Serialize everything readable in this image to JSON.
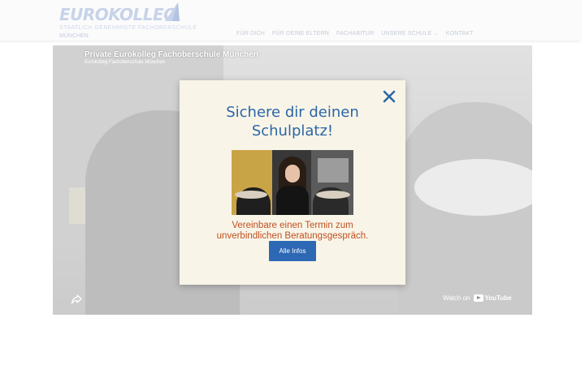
{
  "header": {
    "logo": {
      "name": "EUROKOLLEG",
      "tagline": "STAATLICH GENEHMIGTE FACHOBERSCHULE",
      "city": "MÜNCHEN"
    },
    "nav": [
      {
        "label": "FÜR DICH"
      },
      {
        "label": "FÜR DEINE ELTERN"
      },
      {
        "label": "FACHABITUR"
      },
      {
        "label": "UNSERE SCHULE",
        "has_dropdown": true
      },
      {
        "label": "KONTAKT"
      }
    ]
  },
  "video": {
    "title": "Private Eurokolleg Fachoberschule München",
    "channel": "Eurokolleg Fachoberschule München",
    "watch_on": "Watch on",
    "youtube": "YouTube",
    "icons": {
      "share": "share-icon",
      "youtube": "youtube-logo-icon"
    }
  },
  "modal": {
    "title_line1": "Sichere dir deinen",
    "title_line2": "Schulplatz!",
    "subtitle_line1": "Vereinbare einen Termin zum",
    "subtitle_line2": "unverbindlichen Beratungsgespräch.",
    "button_label": "Alle Infos",
    "close_icon": "close-icon"
  },
  "colors": {
    "brand_blue": "#2c66a7",
    "button_blue": "#2d68b4",
    "accent_orange": "#c14f20",
    "modal_bg": "#f8f5e8"
  }
}
